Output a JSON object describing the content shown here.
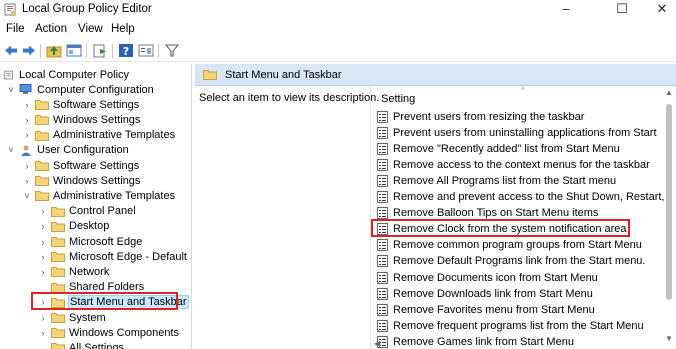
{
  "window": {
    "title": "Local Group Policy Editor",
    "minimize": "–",
    "maximize": "☐",
    "close": "✕"
  },
  "menu": [
    "File",
    "Action",
    "View",
    "Help"
  ],
  "toolbar": [
    "back-arrow-icon",
    "forward-arrow-icon",
    "up-folder-icon",
    "show-hide-tree-icon",
    "export-icon",
    "help-icon",
    "properties-icon",
    "filter-icon"
  ],
  "tree": {
    "root": "Local Computer Policy",
    "items": [
      {
        "label": "Computer Configuration",
        "level": 1,
        "arrow": "⌄"
      },
      {
        "label": "Software Settings",
        "level": 2,
        "arrow": "›"
      },
      {
        "label": "Windows Settings",
        "level": 2,
        "arrow": "›"
      },
      {
        "label": "Administrative Templates",
        "level": 2,
        "arrow": "›"
      },
      {
        "label": "User Configuration",
        "level": 1,
        "arrow": "⌄"
      },
      {
        "label": "Software Settings",
        "level": 2,
        "arrow": "›"
      },
      {
        "label": "Windows Settings",
        "level": 2,
        "arrow": "›"
      },
      {
        "label": "Administrative Templates",
        "level": 2,
        "arrow": "⌄"
      },
      {
        "label": "Control Panel",
        "level": 3,
        "arrow": "›"
      },
      {
        "label": "Desktop",
        "level": 3,
        "arrow": "›"
      },
      {
        "label": "Microsoft Edge",
        "level": 3,
        "arrow": "›"
      },
      {
        "label": "Microsoft Edge - Default Se",
        "level": 3,
        "arrow": "›"
      },
      {
        "label": "Network",
        "level": 3,
        "arrow": "›"
      },
      {
        "label": "Shared Folders",
        "level": 3,
        "arrow": ""
      },
      {
        "label": "Start Menu and Taskbar",
        "level": 3,
        "arrow": "›",
        "selected": true
      },
      {
        "label": "System",
        "level": 3,
        "arrow": "›"
      },
      {
        "label": "Windows Components",
        "level": 3,
        "arrow": "›"
      },
      {
        "label": "All Settings",
        "level": 3,
        "arrow": ""
      }
    ]
  },
  "pane": {
    "header": "Start Menu and Taskbar",
    "description": "Select an item to view its description.",
    "column_header": "Setting",
    "settings": [
      "Prevent users from resizing the taskbar",
      "Prevent users from uninstalling applications from Start",
      "Remove \"Recently added\" list from Start Menu",
      "Remove access to the context menus for the taskbar",
      "Remove All Programs list from the Start menu",
      "Remove and prevent access to the Shut Down, Restart, Sleep...",
      "Remove Balloon Tips on Start Menu items",
      "Remove Clock from the system notification area",
      "Remove common program groups from Start Menu",
      "Remove Default Programs link from the Start menu.",
      "Remove Documents icon from Start Menu",
      "Remove Downloads link from Start Menu",
      "Remove Favorites menu from Start Menu",
      "Remove frequent programs list from the Start Menu",
      "Remove Games link from Start Menu"
    ],
    "highlighted": "Remove Clock from the system notification area"
  },
  "colors": {
    "highlight_border": "#d9262b",
    "selection": "#cce8ff",
    "header_bg": "#d6e6f5",
    "folder": "#e8c15a"
  }
}
